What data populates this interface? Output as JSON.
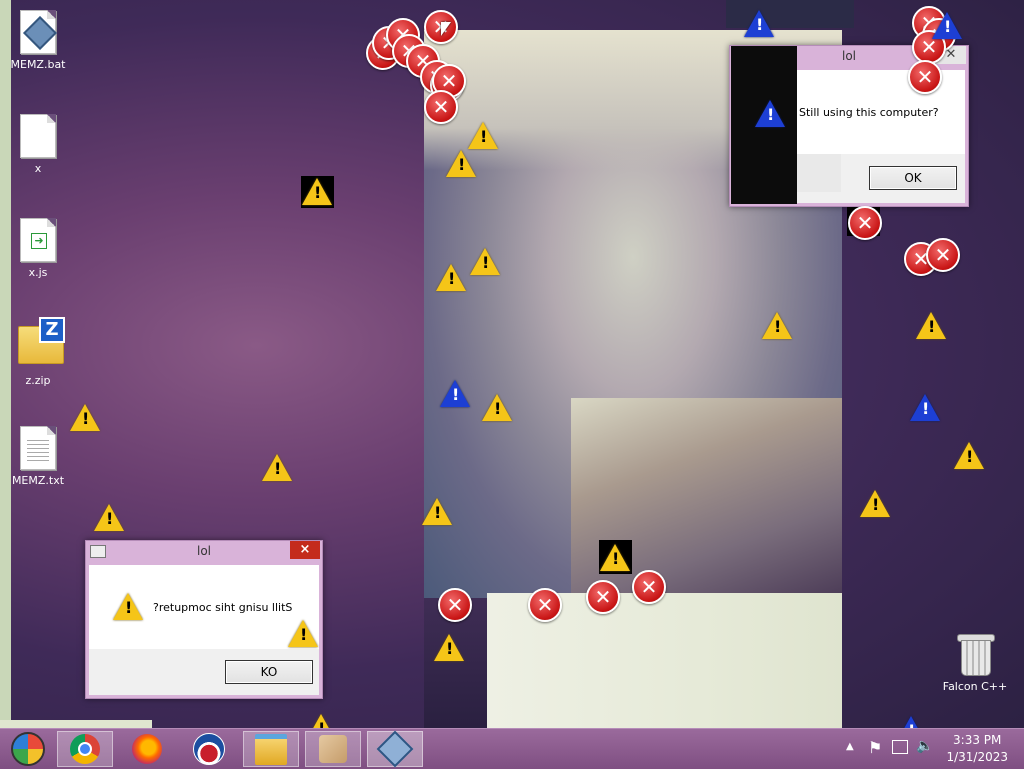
{
  "desktop": {
    "icons": [
      {
        "label": "MEMZ.bat",
        "icon": "batch-file-icon"
      },
      {
        "label": "x",
        "icon": "blank-file-icon"
      },
      {
        "label": "x.js",
        "icon": "script-file-icon"
      },
      {
        "label": "z.zip",
        "icon": "zip-folder-icon"
      },
      {
        "label": "MEMZ.txt",
        "icon": "text-file-icon"
      },
      {
        "label": "Falcon C++",
        "icon": "recycle-bin-icon"
      }
    ]
  },
  "dialog_main": {
    "title": "lol",
    "message": "Still using this computer?",
    "ok_label": "OK",
    "close_glyph": "×"
  },
  "dialog_reversed": {
    "title": "lol",
    "message": "?retupmoc siht gnisu llitS",
    "ok_label": "KO",
    "close_glyph": "×"
  },
  "taskbar": {
    "apps": [
      {
        "name": "start",
        "icon": "windows-start-icon"
      },
      {
        "name": "Google Chrome",
        "icon": "chrome-icon"
      },
      {
        "name": "Firefox",
        "icon": "firefox-icon"
      },
      {
        "name": "Obama",
        "icon": "obama-logo-icon"
      },
      {
        "name": "File Explorer",
        "icon": "folder-icon"
      },
      {
        "name": "Paint",
        "icon": "paint-icon"
      },
      {
        "name": "MEMZ",
        "icon": "memz-icon"
      }
    ],
    "tray_icons": [
      "chevron-up-icon",
      "flag-icon",
      "network-icon",
      "volume-icon"
    ],
    "time": "3:33 PM",
    "date": "1/31/2023"
  },
  "glyphs": {
    "err": "✕",
    "show_hidden": "▲",
    "flag": "⚑",
    "volume": "🔈"
  }
}
